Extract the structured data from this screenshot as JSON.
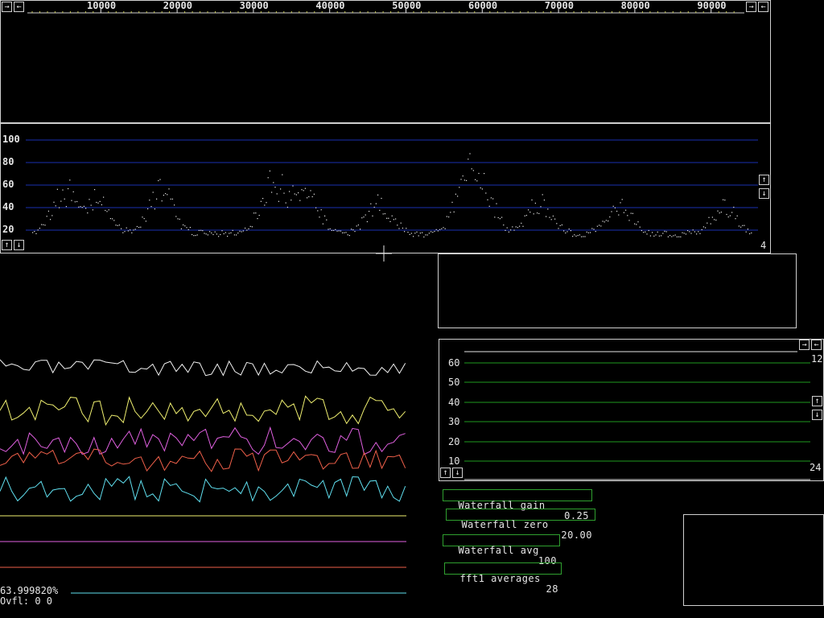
{
  "freq_scale": {
    "ticks": [
      "10000",
      "20000",
      "30000",
      "40000",
      "50000",
      "60000",
      "70000",
      "80000",
      "90000"
    ],
    "nav_left": "←",
    "nav_right": "→"
  },
  "spectrum": {
    "y_ticks": [
      "100",
      "80",
      "60",
      "40",
      "20"
    ],
    "up_label": "↑",
    "down_label": "↓",
    "avg_number": "4"
  },
  "waterfall_params": {
    "gain_label": "Waterfall gain",
    "gain_value": "0.25",
    "zero_label": "Waterfall zero",
    "zero_value": "20.00",
    "avg_label": "Waterfall avg",
    "avg_value": "100",
    "fft1_label": "fft1 averages",
    "fft1_value": "28"
  },
  "level_meter": {
    "y_ticks": [
      "60",
      "50",
      "40",
      "30",
      "20",
      "10"
    ],
    "top_number": "12",
    "bottom_number": "24",
    "nav_right": "→",
    "nav_left": "←",
    "up_label": "↑",
    "down_label": "↓"
  },
  "status": {
    "percent": "63.999820%",
    "overflow": "Ovfl: 0 0"
  },
  "colors": {
    "grid_blue": "#1a2fb0",
    "grid_green": "#1f9a1f",
    "trace_white": "#f2f2f2",
    "trace_yellow": "#f0f070",
    "trace_magenta": "#e060e0",
    "trace_red": "#f0604a",
    "trace_cyan": "#60e0f0"
  }
}
